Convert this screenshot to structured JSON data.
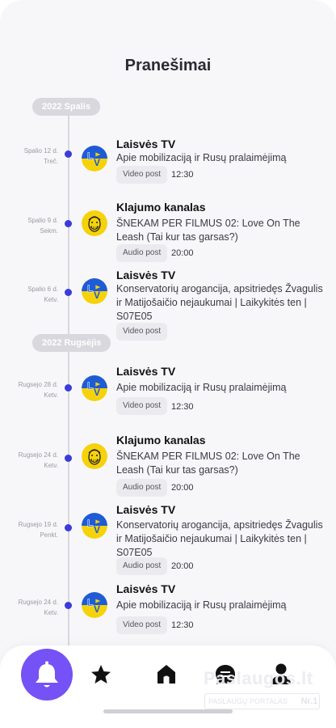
{
  "page": {
    "title": "Pranešimai"
  },
  "months": [
    {
      "label": "2022 Spalis"
    },
    {
      "label": "2022 Rugsėjis"
    }
  ],
  "entries": [
    {
      "date1": "Spalio 12 d.",
      "date2": "Treč.",
      "channel": "Laisvės TV",
      "avatar": "ltv-logo",
      "desc": "Apie mobilizaciją ir Rusų pralaimėjimą",
      "tag": "Video post",
      "time": "12:30"
    },
    {
      "date1": "Spalio 9 d.",
      "date2": "Sekm.",
      "channel": "Klajumo kanalas",
      "avatar": "klajumo-face",
      "desc": "ŠNEKAM PER FILMUS 02: Love On The Leash (Tai kur tas garsas?)",
      "tag": "Audio post",
      "time": "20:00"
    },
    {
      "date1": "Spalio 6 d.",
      "date2": "Ketv.",
      "channel": "Laisvės TV",
      "avatar": "ltv-logo",
      "desc": "Konservatorių arogancija, apsitriedęs Žvagulis ir Matijošaičio nejaukumai | Laikykitės ten | S07E05",
      "tag": "Video post",
      "time": ""
    },
    {
      "date1": "Rugsejo 28 d.",
      "date2": "Ketv.",
      "channel": "Laisvės TV",
      "avatar": "ltv-logo",
      "desc": "Apie mobilizaciją ir Rusų pralaimėjimą",
      "tag": "Video post",
      "time": "12:30"
    },
    {
      "date1": "Rugsejo 24 d.",
      "date2": "Ketv.",
      "channel": "Klajumo kanalas",
      "avatar": "klajumo-face",
      "desc": "ŠNEKAM PER FILMUS 02: Love On The Leash (Tai kur tas garsas?)",
      "tag": "Audio post",
      "time": "20:00"
    },
    {
      "date1": "Rugsejo 19 d.",
      "date2": "Penkt.",
      "channel": "Laisvės TV",
      "avatar": "ltv-logo",
      "desc": "Konservatorių arogancija, apsitriedęs Žvagulis ir Matijošaičio nejaukumai | Laikykitės ten | S07E05",
      "tag": "Audio post",
      "time": "20:00"
    },
    {
      "date1": "Rugsejo 24 d.",
      "date2": "Ketv.",
      "channel": "Laisvės TV",
      "avatar": "ltv-logo",
      "desc": "Apie mobilizaciją ir Rusų pralaimėjimą",
      "tag": "Video post",
      "time": "12:30"
    }
  ],
  "nav": {
    "items": [
      {
        "icon": "bell-icon",
        "active": true
      },
      {
        "icon": "star-icon",
        "active": false
      },
      {
        "icon": "home-icon",
        "active": false
      },
      {
        "icon": "chat-icon",
        "active": false
      },
      {
        "icon": "profile-icon",
        "active": false
      }
    ]
  },
  "watermark": {
    "text": "Paslaugos.lt",
    "sub": "PASLAUGŲ PORTALAS",
    "rank": "Nr.1"
  },
  "colors": {
    "accent": "#7552f5",
    "dot": "#3b3bdc",
    "ltv_blue": "#1e5bd8",
    "ltv_yellow": "#f5d20a",
    "klajumo_yellow": "#f5d20a"
  }
}
